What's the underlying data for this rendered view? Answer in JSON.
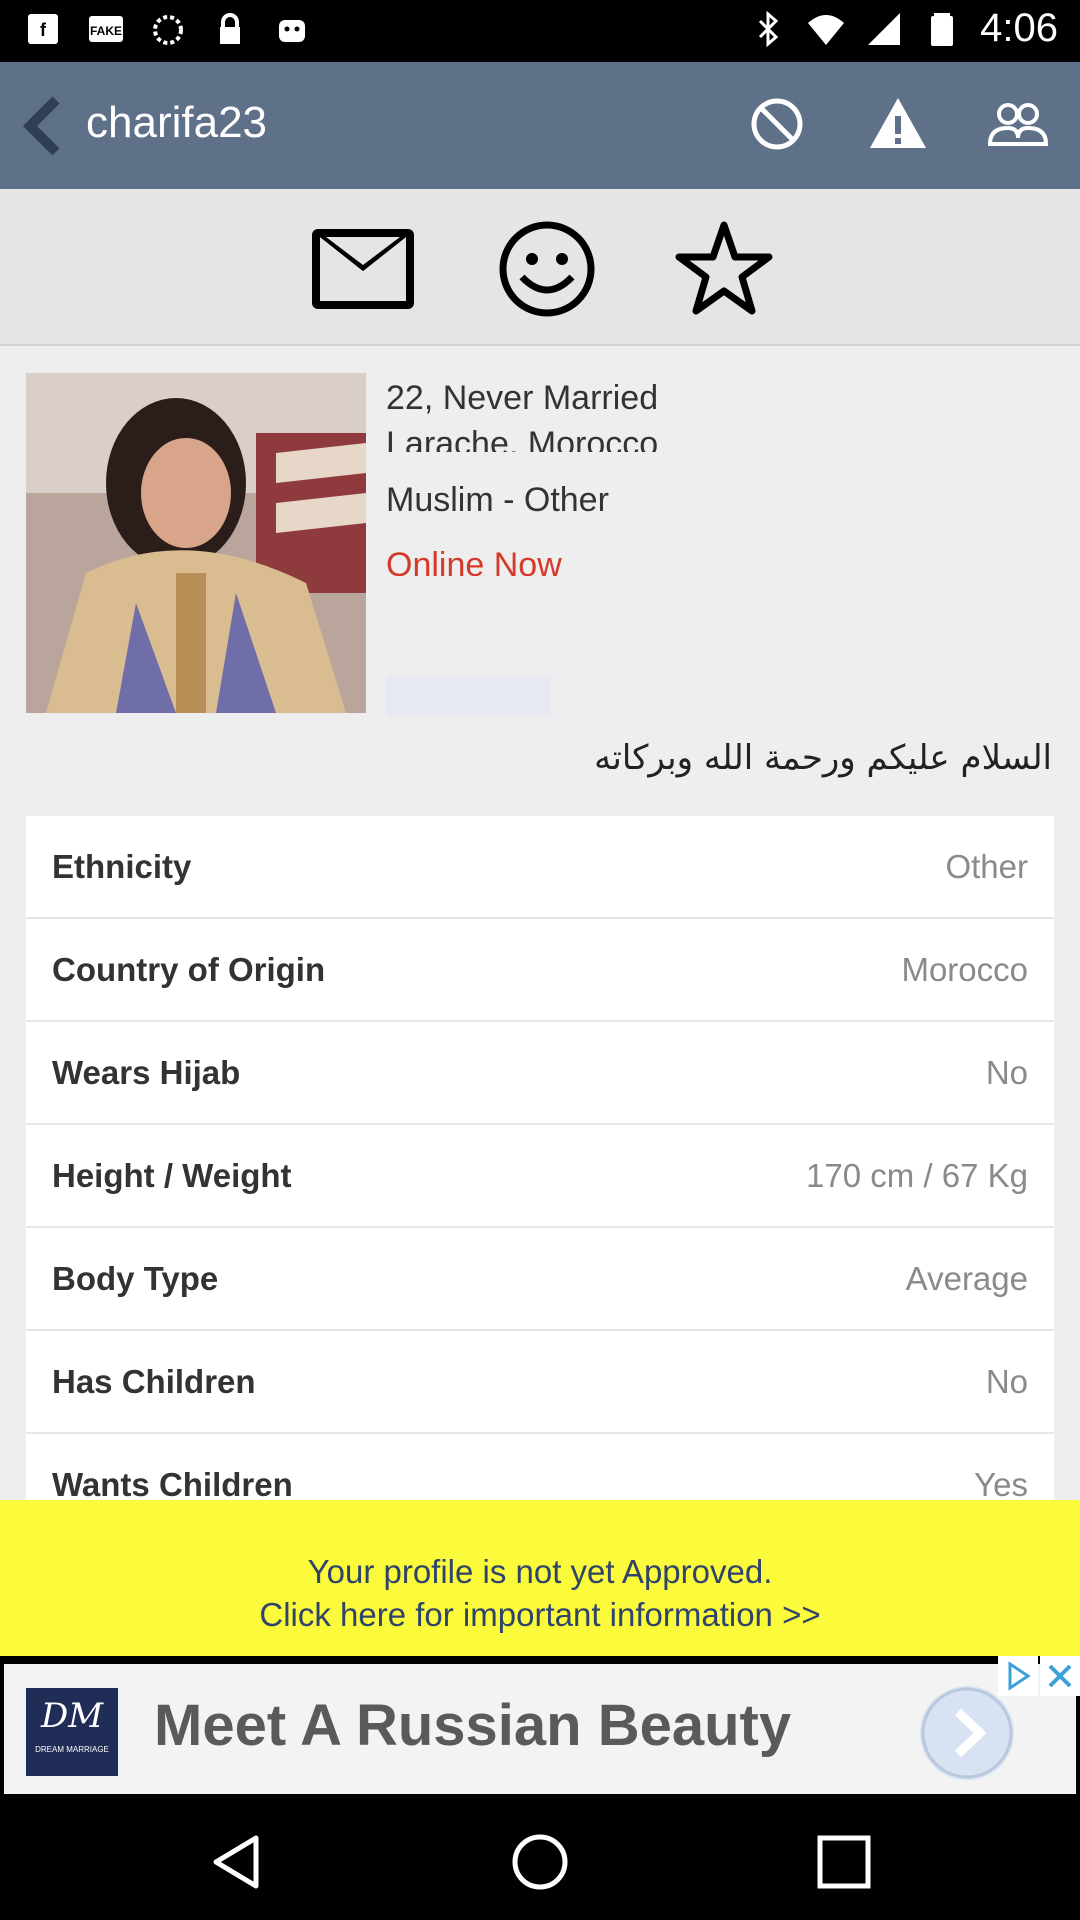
{
  "status_bar": {
    "time": "4:06",
    "left_icons": [
      "fb-messenger-icon",
      "fake-gps-icon",
      "sync-icon",
      "lock-icon",
      "android-icon"
    ],
    "right_icons": [
      "bluetooth-icon",
      "wifi-icon",
      "signal-icon",
      "battery-icon"
    ]
  },
  "app_bar": {
    "title": "charifa23",
    "icons": [
      "block-icon",
      "report-icon",
      "friends-icon"
    ]
  },
  "action_strip": {
    "icons": [
      "mail-icon",
      "smile-icon",
      "star-icon"
    ]
  },
  "profile": {
    "age_status": "22, Never Married",
    "location": "Larache, Morocco",
    "religion": "Muslim - Other",
    "online": "Online Now",
    "greeting": "السلام عليكم ورحمة الله وبركاته"
  },
  "details": [
    {
      "label": "Ethnicity",
      "value": "Other"
    },
    {
      "label": "Country of Origin",
      "value": "Morocco"
    },
    {
      "label": "Wears Hijab",
      "value": "No"
    },
    {
      "label": "Height / Weight",
      "value": "170 cm / 67 Kg"
    },
    {
      "label": "Body Type",
      "value": "Average"
    },
    {
      "label": "Has Children",
      "value": "No"
    },
    {
      "label": "Wants Children",
      "value": "Yes"
    }
  ],
  "notice": {
    "line1": "Your profile is not yet Approved.",
    "line2": "Click here for important information >>"
  },
  "ad": {
    "logo_text": "DREAM MARRIAGE",
    "headline": "Meet A Russian Beauty"
  },
  "colors": {
    "app_bar": "#5e7189",
    "online": "#d43a2a",
    "notice_bg": "#fbfb3c",
    "notice_text": "#2f4468"
  }
}
